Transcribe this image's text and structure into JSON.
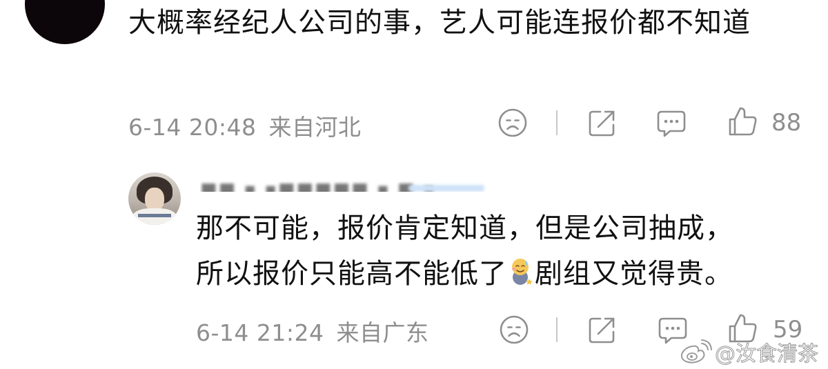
{
  "comments": [
    {
      "text": "大概率经纪人公司的事，艺人可能连报价都不知道",
      "date": "6-14 20:48",
      "location": "来自河北",
      "likes": "88"
    },
    {
      "text_line1": "那不可能，报价肯定知道，但是公司抽成，",
      "text_line2_before": "所以报价只能高不能低了",
      "text_line2_after": "剧组又觉得贵。",
      "date": "6-14 21:24",
      "location": "来自广东",
      "likes": "59",
      "emoji": "sweat-smile-sticker"
    }
  ],
  "icons": {
    "dislike": "sad-face-icon",
    "share": "share-icon",
    "reply": "comment-bubble-icon",
    "like": "thumbs-up-icon"
  },
  "watermark": {
    "text": "@汝食清茶",
    "logo": "weibo-logo"
  },
  "colors": {
    "text": "#111111",
    "meta": "#8e8e8e",
    "icon": "#8e8e8e",
    "background": "#ffffff"
  }
}
